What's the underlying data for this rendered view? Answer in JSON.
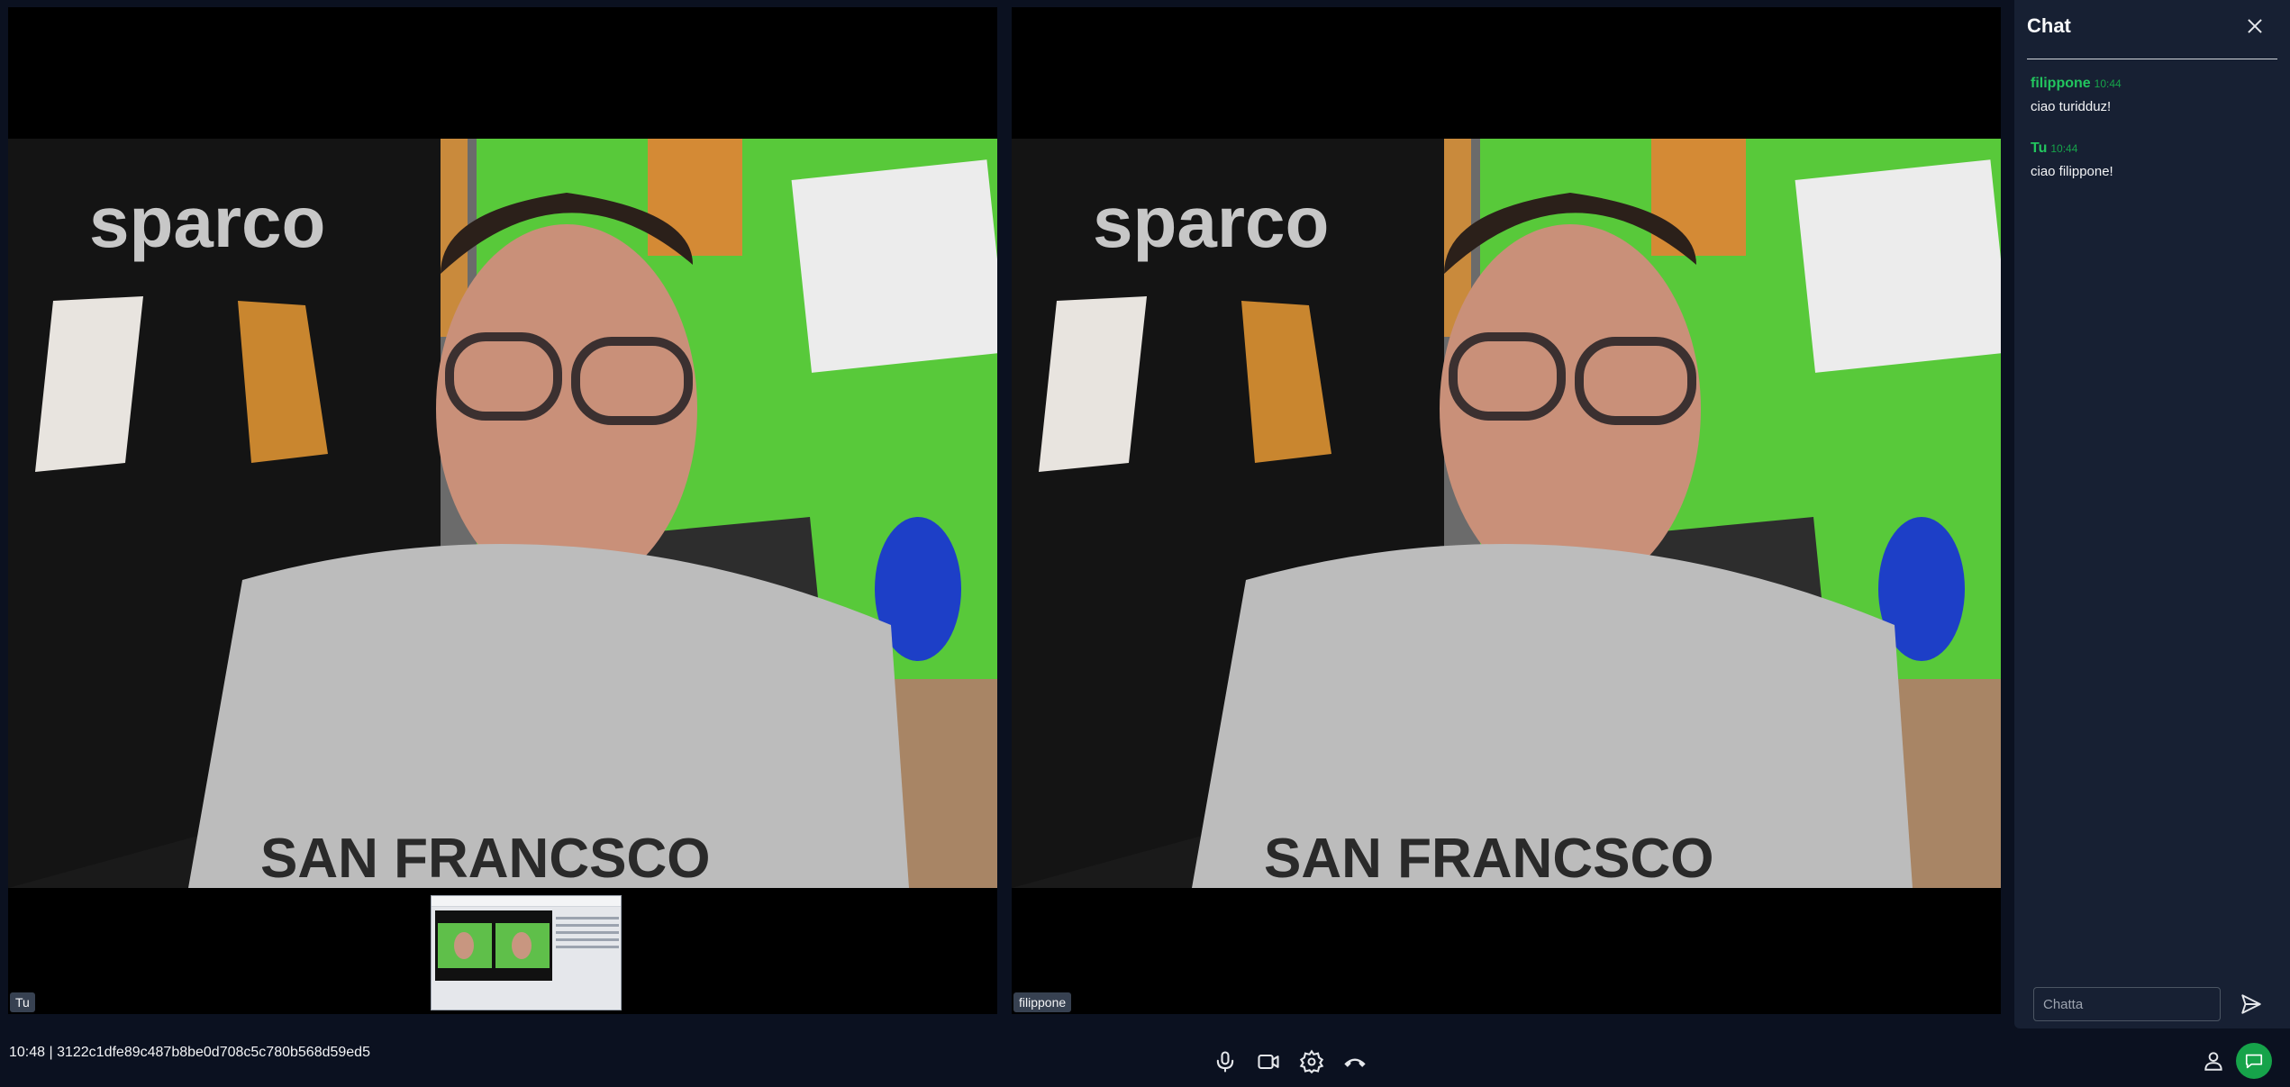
{
  "tiles": {
    "local_name": "Tu",
    "remote_name": "filippone"
  },
  "chat": {
    "title": "Chat",
    "messages": [
      {
        "author": "filippone",
        "time": "10:44",
        "text": "ciao turidduz!"
      },
      {
        "author": "Tu",
        "time": "10:44",
        "text": "ciao filippone!"
      }
    ],
    "input_placeholder": "Chatta"
  },
  "footer": {
    "meeting_info": "10:48 | 3122c1dfe89c487b8be0d708c5c780b568d59ed5"
  },
  "colors": {
    "accent": "#22c55e",
    "chat_bg": "#172033",
    "page_bg": "#0b1120",
    "wall_green": "#5fd13b"
  },
  "icons": [
    "microphone-icon",
    "video-camera-icon",
    "settings-gear-icon",
    "hang-up-icon",
    "participants-icon",
    "chat-bubble-icon",
    "send-icon",
    "close-icon"
  ]
}
